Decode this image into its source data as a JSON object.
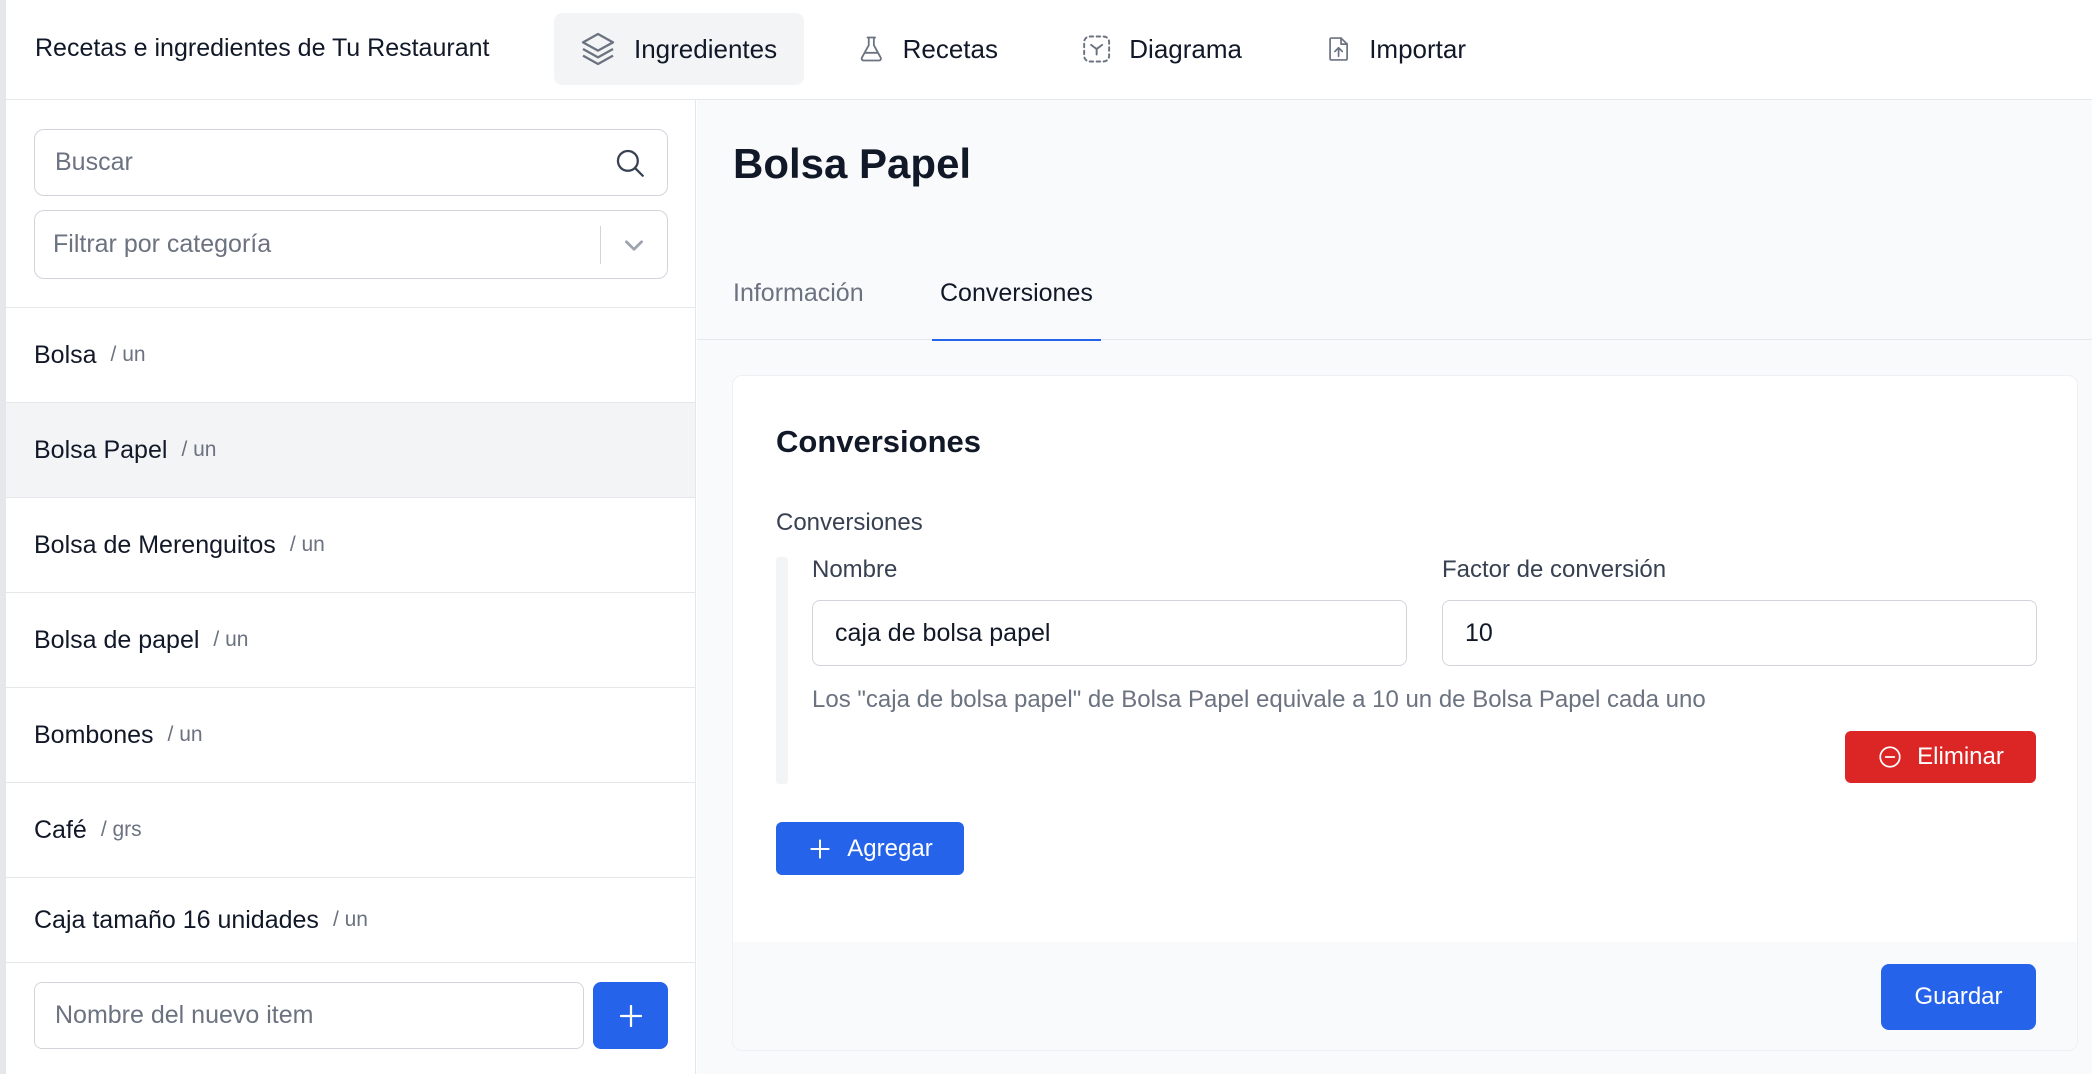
{
  "app": {
    "title": "Recetas e ingredientes de Tu Restaurant"
  },
  "nav": [
    {
      "label": "Ingredientes",
      "icon": "layers-icon",
      "active": true
    },
    {
      "label": "Recetas",
      "icon": "flask-icon",
      "active": false
    },
    {
      "label": "Diagrama",
      "icon": "diagram-icon",
      "active": false
    },
    {
      "label": "Importar",
      "icon": "file-upload-icon",
      "active": false
    }
  ],
  "sidebar": {
    "search_placeholder": "Buscar",
    "filter_placeholder": "Filtrar por categoría",
    "items": [
      {
        "name": "Bolsa",
        "unit": "/ un",
        "selected": false
      },
      {
        "name": "Bolsa Papel",
        "unit": "/ un",
        "selected": true
      },
      {
        "name": "Bolsa de Merenguitos",
        "unit": "/ un",
        "selected": false
      },
      {
        "name": "Bolsa de papel",
        "unit": "/ un",
        "selected": false
      },
      {
        "name": "Bombones",
        "unit": "/ un",
        "selected": false
      },
      {
        "name": "Café",
        "unit": "/ grs",
        "selected": false
      },
      {
        "name": "Caja tamaño 16 unidades",
        "unit": "/ un",
        "selected": false
      }
    ],
    "new_item_placeholder": "Nombre del nuevo item"
  },
  "main": {
    "title": "Bolsa Papel",
    "tabs": [
      {
        "label": "Información",
        "active": false
      },
      {
        "label": "Conversiones",
        "active": true
      }
    ],
    "card": {
      "title": "Conversiones",
      "section_label": "Conversiones",
      "name_label": "Nombre",
      "factor_label": "Factor de conversión",
      "name_value": "caja de bolsa papel",
      "factor_value": "10",
      "description": "Los \"caja de bolsa papel\" de Bolsa Papel equivale a 10 un de Bolsa Papel cada uno",
      "delete_label": "Eliminar",
      "add_label": "Agregar",
      "save_label": "Guardar"
    }
  },
  "colors": {
    "primary": "#2563eb",
    "danger": "#dc2626",
    "muted_text": "#6b7280",
    "border": "#e5e7eb"
  }
}
